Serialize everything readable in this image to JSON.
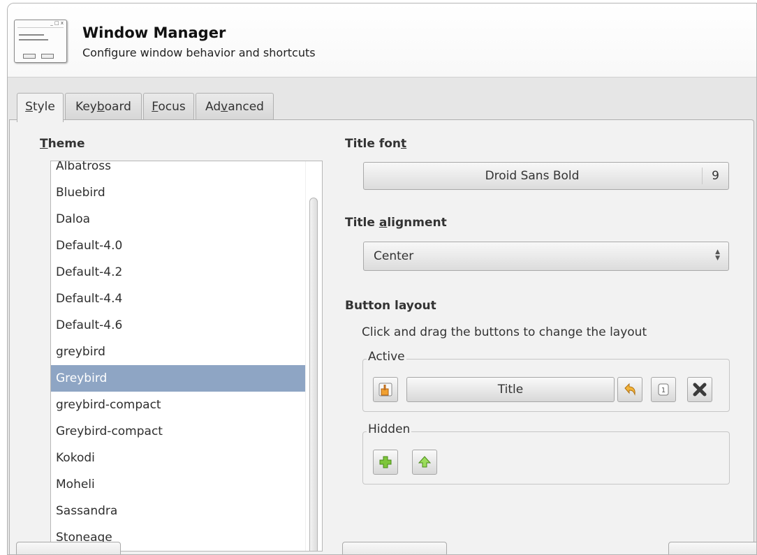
{
  "header": {
    "title": "Window Manager",
    "subtitle": "Configure window behavior and shortcuts"
  },
  "tabs": [
    {
      "label": "Style",
      "mnemonic_index": 0,
      "active": true
    },
    {
      "label": "Keyboard",
      "mnemonic_index": 3,
      "active": false
    },
    {
      "label": "Focus",
      "mnemonic_index": 0,
      "active": false
    },
    {
      "label": "Advanced",
      "mnemonic_index": 2,
      "active": false
    }
  ],
  "theme": {
    "label": "Theme",
    "items": [
      "Albatross",
      "Bluebird",
      "Daloa",
      "Default-4.0",
      "Default-4.2",
      "Default-4.4",
      "Default-4.6",
      "greybird",
      "Greybird",
      "greybird-compact",
      "Greybird-compact",
      "Kokodi",
      "Moheli",
      "Sassandra",
      "Stoneage"
    ],
    "selected": "Greybird",
    "selection_color": "#8ea5c4"
  },
  "title_font": {
    "label": "Title font",
    "font_name": "Droid Sans Bold",
    "font_size": "9"
  },
  "title_alignment": {
    "label": "Title alignment",
    "value": "Center"
  },
  "button_layout": {
    "label": "Button layout",
    "hint": "Click and drag the buttons to change the layout",
    "active_label": "Active",
    "title_button": "Title",
    "active_icons": [
      "menu-icon",
      "shade-icon",
      "stick-icon",
      "close-icon"
    ],
    "hidden_label": "Hidden",
    "hidden_icons": [
      "maximize-icon",
      "hide-icon"
    ]
  }
}
